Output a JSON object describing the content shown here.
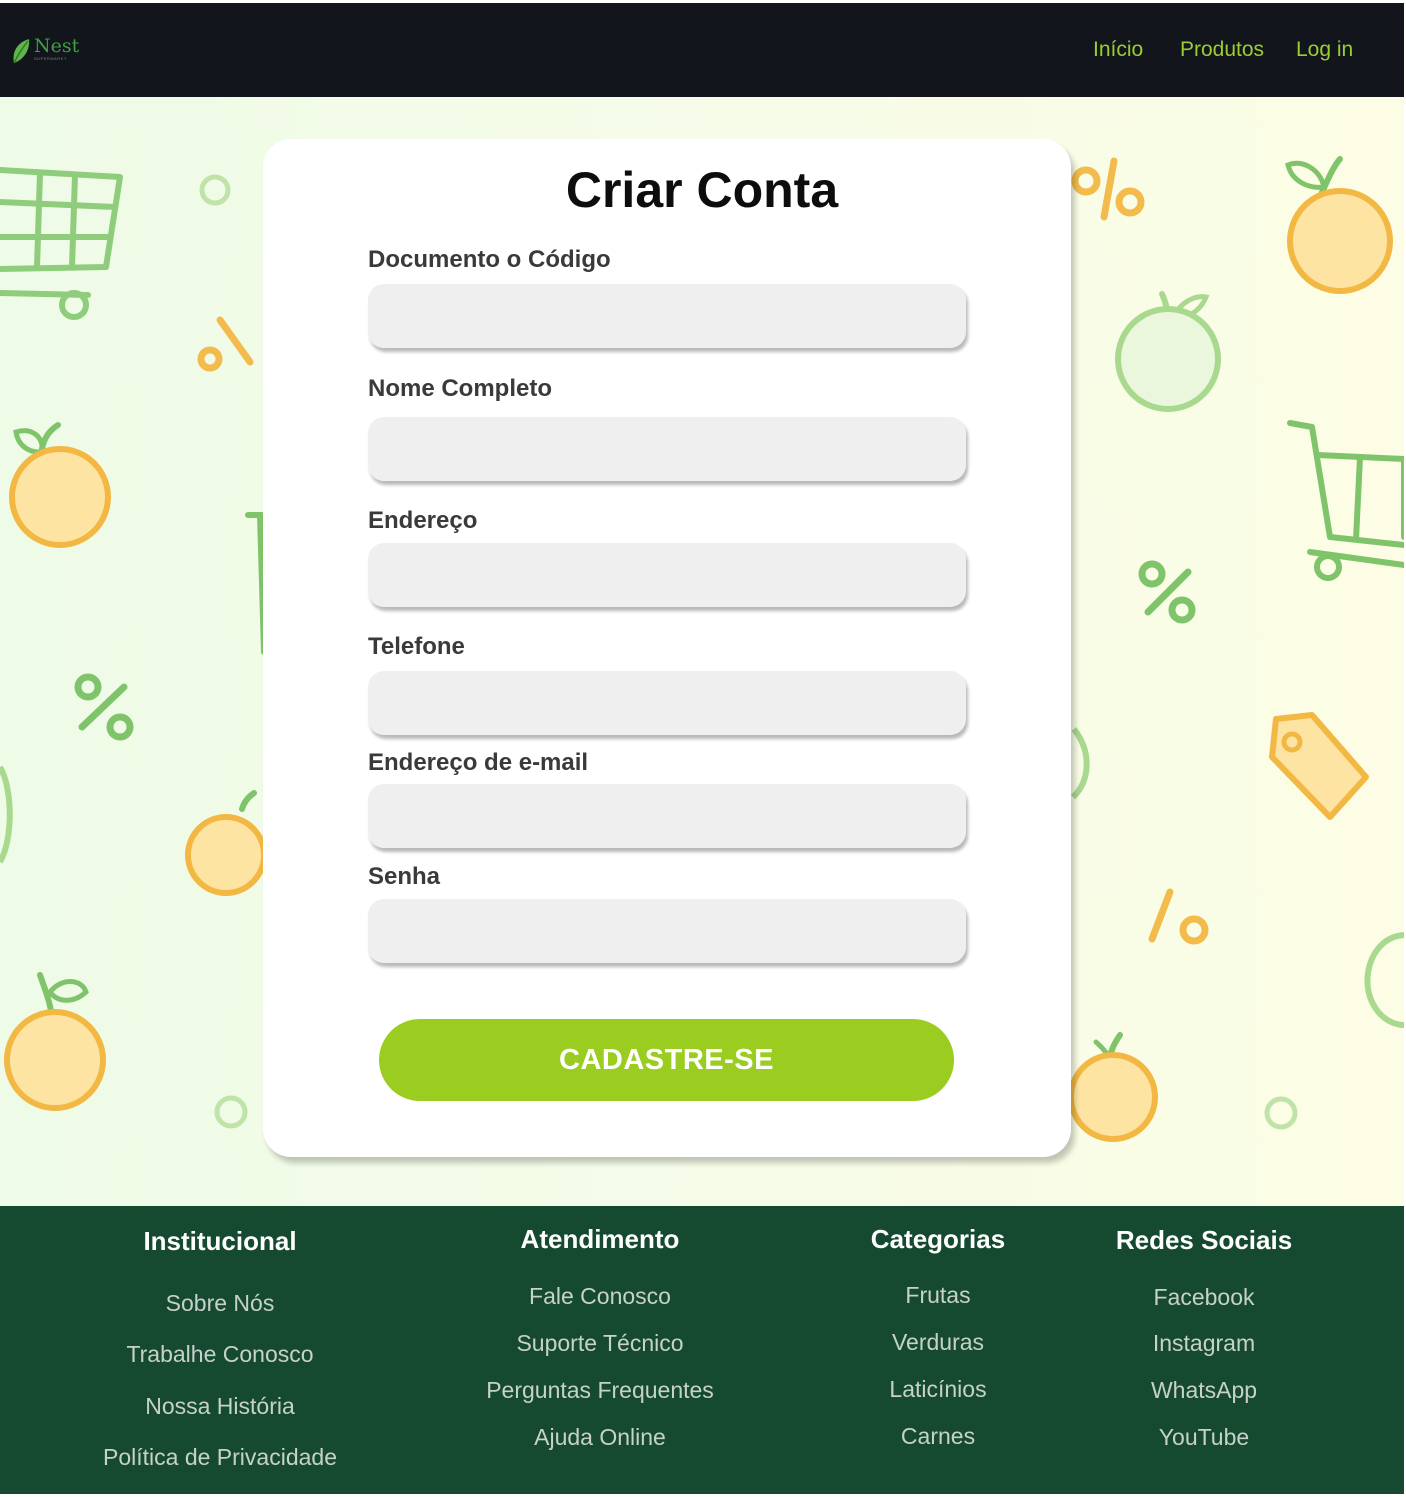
{
  "header": {
    "logo": {
      "name": "Nest",
      "tagline": "SUPERMARKT"
    },
    "nav": {
      "home": "Início",
      "products": "Produtos",
      "login": "Log in"
    },
    "nav_color": "#9acd32"
  },
  "form": {
    "title": "Criar Conta",
    "fields": [
      {
        "label": "Documento o Código",
        "value": ""
      },
      {
        "label": "Nome Completo",
        "value": ""
      },
      {
        "label": "Endereço",
        "value": ""
      },
      {
        "label": "Telefone",
        "value": ""
      },
      {
        "label": "Endereço de e-mail",
        "value": ""
      },
      {
        "label": "Senha",
        "value": ""
      }
    ],
    "submit_label": "CADASTRE-SE",
    "accent_color": "#9acd20"
  },
  "background": {
    "icons": [
      "shopping-cart-icon",
      "apple-icon",
      "orange-icon",
      "percent-icon",
      "price-tag-icon",
      "circle-icon"
    ]
  },
  "footer": {
    "background_color": "#154a30",
    "columns": [
      {
        "title": "Institucional",
        "links": [
          "Sobre Nós",
          "Trabalhe Conosco",
          "Nossa História",
          "Política de Privacidade"
        ]
      },
      {
        "title": "Atendimento",
        "links": [
          "Fale Conosco",
          "Suporte Técnico",
          "Perguntas Frequentes",
          "Ajuda Online"
        ]
      },
      {
        "title": "Categorias",
        "links": [
          "Frutas",
          "Verduras",
          "Laticínios",
          "Carnes"
        ]
      },
      {
        "title": "Redes Sociais",
        "links": [
          "Facebook",
          "Instagram",
          "WhatsApp",
          "YouTube"
        ]
      }
    ]
  }
}
